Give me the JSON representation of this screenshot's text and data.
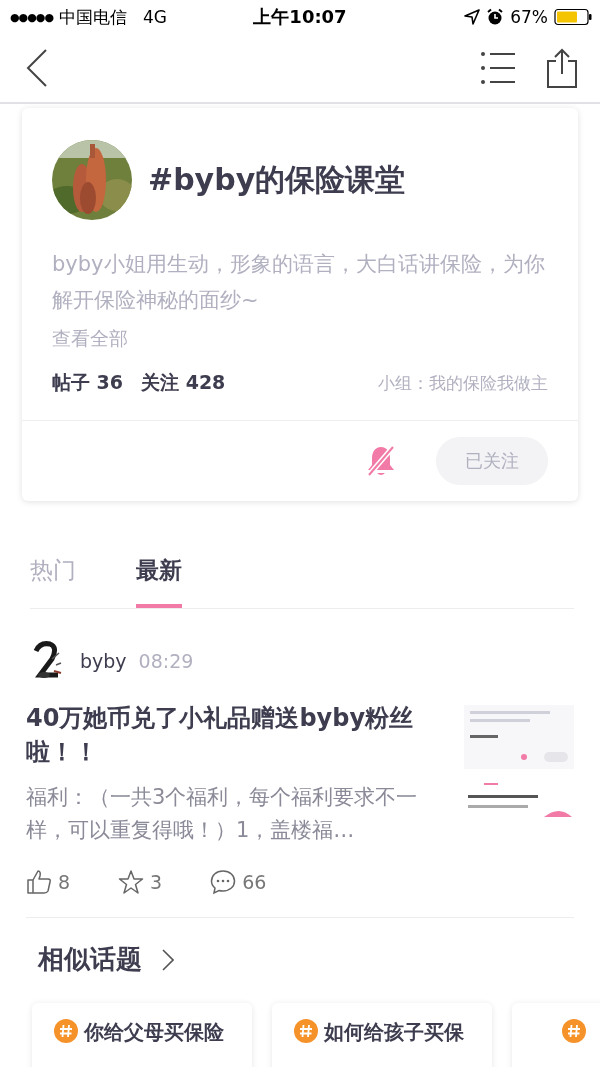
{
  "status_bar": {
    "signal": "●●●●●",
    "carrier": "中国电信",
    "network": "4G",
    "time": "上午10:07",
    "battery": "67%"
  },
  "topic": {
    "title": "#byby的保险课堂",
    "description": "byby小姐用生动，形象的语言，大白话讲保险，为你解开保险神秘的面纱~",
    "more_link": "查看全部",
    "posts": "帖子 36",
    "followers": "关注 428",
    "group": "小组：我的保险我做主",
    "notifications_muted": true,
    "follow_button": "已关注"
  },
  "tabs": [
    {
      "label": "热门",
      "selected": false
    },
    {
      "label": "最新",
      "selected": true
    }
  ],
  "posts": [
    {
      "author": "byby",
      "time": "08:29",
      "title": "40万她币兑了小礼品赠送byby粉丝啦！！",
      "excerpt": "福利：（一共3个福利，每个福利要求不一样，可以重复得哦！）1，盖楼福…",
      "likes": "8",
      "favorites": "3",
      "comments": "66"
    }
  ],
  "similar": {
    "heading": "相似话题",
    "topics": [
      {
        "title": "你给父母买保险"
      },
      {
        "title": "如何给孩子买保"
      }
    ]
  }
}
